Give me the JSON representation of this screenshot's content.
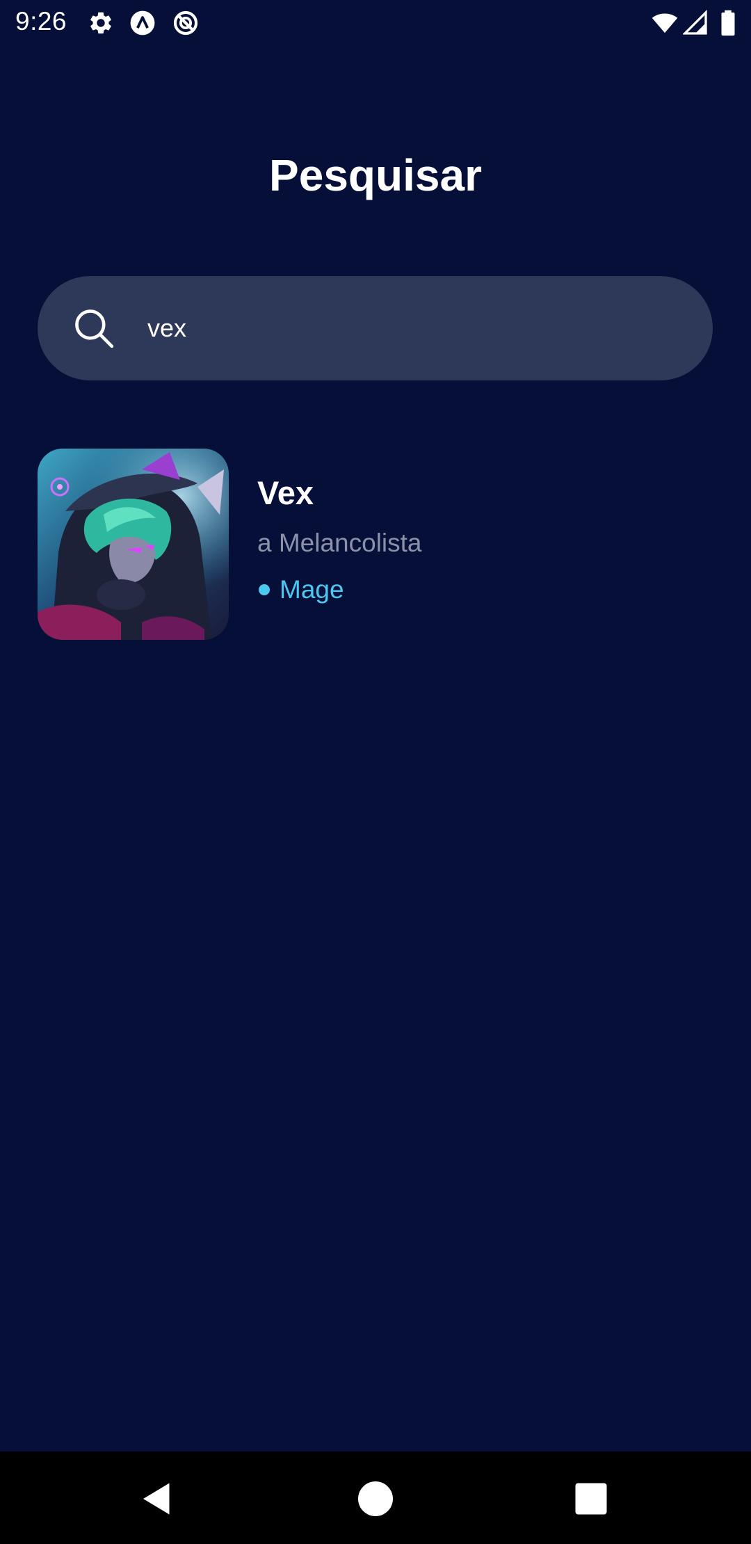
{
  "status_bar": {
    "time": "9:26",
    "icons_left": [
      "settings-icon",
      "app-a-icon",
      "app-circle-icon"
    ],
    "icons_right": [
      "wifi-icon",
      "signal-icon",
      "battery-icon"
    ]
  },
  "header": {
    "title": "Pesquisar"
  },
  "search": {
    "value": "vex",
    "icon": "search-icon"
  },
  "results": [
    {
      "name": "Vex",
      "subtitle": "a Melancolista",
      "role": "Mage"
    }
  ],
  "colors": {
    "background": "#050f38",
    "search_bg": "#2e3858",
    "subtitle": "#8b91a8",
    "role_accent": "#4cc8f0",
    "nav_bar": "#000000"
  },
  "nav_bar": {
    "buttons": [
      "back-icon",
      "home-icon",
      "recents-icon"
    ]
  }
}
